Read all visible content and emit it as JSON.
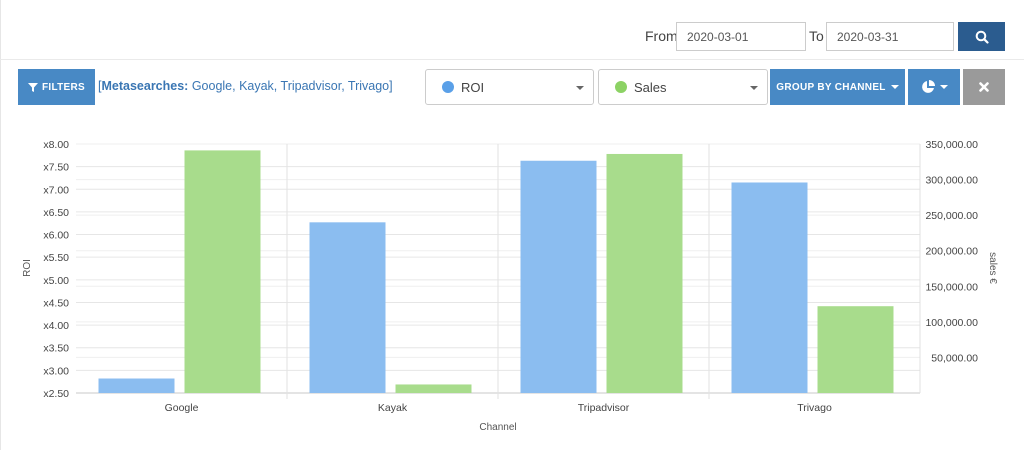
{
  "filters": {
    "from_label": "From",
    "from_value": "2020-03-01",
    "to_label": "To",
    "to_value": "2020-03-31"
  },
  "toolbar": {
    "filters_label": "FILTERS",
    "meta_prefix": "[",
    "meta_title": "Metasearches:",
    "meta_values": " Google, Kayak, Tripadvisor, Trivago",
    "meta_suffix": "]",
    "metric1": "ROI",
    "metric2": "Sales",
    "group_label": "GROUP BY CHANNEL",
    "colors": {
      "roi": "#8bbdf0",
      "sales": "#a8dc8c",
      "button": "#4889c5",
      "search": "#2b5c8f"
    }
  },
  "chart_data": {
    "type": "bar",
    "categories": [
      "Google",
      "Kayak",
      "Tripadvisor",
      "Trivago"
    ],
    "series": [
      {
        "name": "ROI",
        "axis": "left",
        "color": "#8bbdf0",
        "values": [
          2.82,
          6.27,
          7.63,
          7.15
        ]
      },
      {
        "name": "Sales",
        "axis": "right",
        "color": "#a8dc8c",
        "values": [
          341000,
          12000,
          336000,
          122000
        ]
      }
    ],
    "xlabel": "Channel",
    "ylabel_left": "ROI",
    "ylabel_right": "sales €",
    "ylim_left": [
      2.5,
      8.0
    ],
    "ylim_right": [
      0,
      350000
    ],
    "yticks_left": [
      "x8.00",
      "x7.50",
      "x7.00",
      "x6.50",
      "x6.00",
      "x5.50",
      "x5.00",
      "x4.50",
      "x4.00",
      "x3.50",
      "x3.00",
      "x2.50"
    ],
    "yticks_right": [
      "350,000.00",
      "300,000.00",
      "250,000.00",
      "200,000.00",
      "150,000.00",
      "100,000.00",
      "50,000.00"
    ],
    "grid": true
  }
}
